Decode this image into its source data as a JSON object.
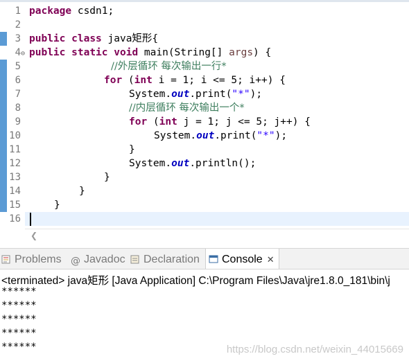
{
  "editor": {
    "line_numbers": [
      "1",
      "2",
      "3",
      "4",
      "5",
      "6",
      "7",
      "8",
      "9",
      "10",
      "11",
      "12",
      "13",
      "14",
      "15",
      "16"
    ],
    "fold_marker": "⊖",
    "code": {
      "l1_kw": "package",
      "l1_rest": " csdn1;",
      "l3_kw1": "public",
      "l3_kw2": "class",
      "l3_rest": " java矩形{",
      "l4_kw1": "public",
      "l4_kw2": "static",
      "l4_kw3": "void",
      "l4_main": " main(String[] ",
      "l4_param": "args",
      "l4_end": ") {",
      "l5_comment": "//外层循环 每次输出一行*",
      "l6_kw1": "for",
      "l6_a": " (",
      "l6_kw2": "int",
      "l6_b": " i = 1; i <= 5; i++) {",
      "l7_a": "System.",
      "l7_field": "out",
      "l7_b": ".print(",
      "l7_str": "\"*\"",
      "l7_c": ");",
      "l8_comment": "//内层循环 每次输出一个*",
      "l9_kw1": "for",
      "l9_a": " (",
      "l9_kw2": "int",
      "l9_b": " j = 1; j <= 5; j++) {",
      "l10_a": "System.",
      "l10_field": "out",
      "l10_b": ".print(",
      "l10_str": "\"*\"",
      "l10_c": ");",
      "l11": "}",
      "l12_a": "System.",
      "l12_field": "out",
      "l12_b": ".println();",
      "l13": "}",
      "l14": "}",
      "l15": "}"
    }
  },
  "panel": {
    "tabs": {
      "problems": "Problems",
      "javadoc": "Javadoc",
      "declaration": "Declaration",
      "console": "Console",
      "close_glyph": "✕"
    },
    "console": {
      "terminated": "<terminated> java矩形 [Java Application] C:\\Program Files\\Java\\jre1.8.0_181\\bin\\j",
      "output": [
        "******",
        "******",
        "******",
        "******",
        "******"
      ]
    }
  },
  "watermark": "https://blog.csdn.net/weixin_44015669",
  "colors": {
    "keyword": "#7f0055",
    "comment": "#3f7f5f",
    "string": "#2a00ff",
    "field": "#0000c0",
    "param": "#6a3e3e",
    "current_line": "#e8f2fe",
    "change_bar": "#5b9bd5"
  }
}
